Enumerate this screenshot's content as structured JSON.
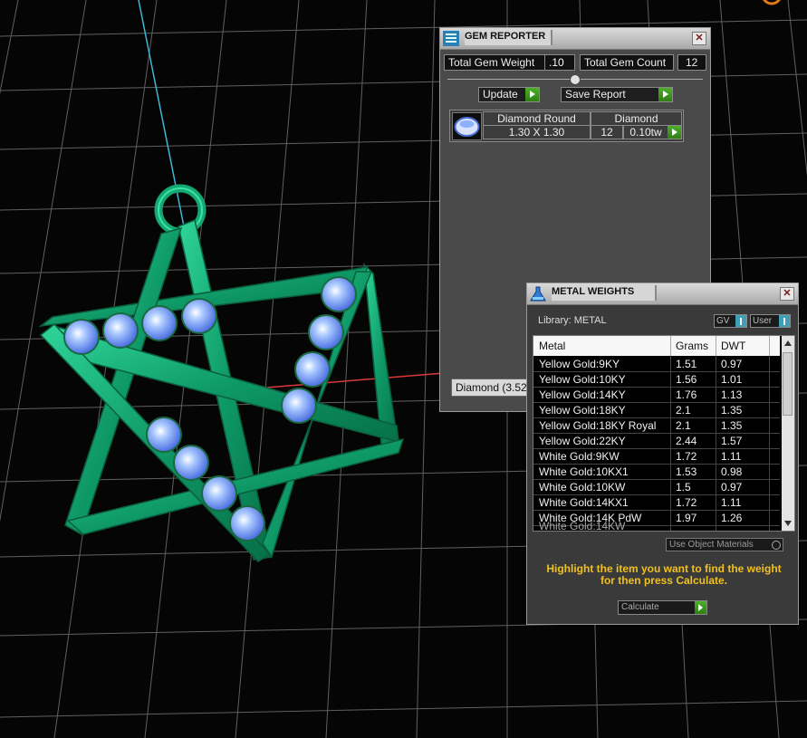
{
  "gem_reporter": {
    "title": "GEM REPORTER",
    "close": "✕",
    "total_weight_label": "Total Gem Weight",
    "total_weight_value": ".10",
    "total_count_label": "Total Gem Count",
    "total_count_value": "12",
    "update_label": "Update",
    "save_report_label": "Save Report",
    "table": {
      "header_name": "Diamond Round",
      "header_type": "Diamond",
      "size": "1.30 X 1.30",
      "count": "12",
      "weight": "0.10tw"
    },
    "footer_text": "Diamond   (3.52"
  },
  "metal_weights": {
    "title": "METAL WEIGHTS",
    "close": "✕",
    "library_label": "Library: METAL",
    "gv_label": "GV",
    "user_label": "User",
    "columns": [
      "Metal",
      "Grams",
      "DWT"
    ],
    "rows": [
      {
        "metal": "Yellow Gold:9KY",
        "grams": "1.51",
        "dwt": "0.97"
      },
      {
        "metal": "Yellow Gold:10KY",
        "grams": "1.56",
        "dwt": "1.01"
      },
      {
        "metal": "Yellow Gold:14KY",
        "grams": "1.76",
        "dwt": "1.13"
      },
      {
        "metal": "Yellow Gold:18KY",
        "grams": "2.1",
        "dwt": "1.35"
      },
      {
        "metal": "Yellow Gold:18KY Royal",
        "grams": "2.1",
        "dwt": "1.35"
      },
      {
        "metal": "Yellow Gold:22KY",
        "grams": "2.44",
        "dwt": "1.57"
      },
      {
        "metal": "White Gold:9KW",
        "grams": "1.72",
        "dwt": "1.11"
      },
      {
        "metal": "White Gold:10KX1",
        "grams": "1.53",
        "dwt": "0.98"
      },
      {
        "metal": "White Gold:10KW",
        "grams": "1.5",
        "dwt": "0.97"
      },
      {
        "metal": "White Gold:14KX1",
        "grams": "1.72",
        "dwt": "1.11"
      },
      {
        "metal": "White Gold:14K PdW",
        "grams": "1.97",
        "dwt": "1.26"
      }
    ],
    "use_object_materials": "Use Object Materials",
    "hint": "Highlight the item you want to find the weight for then press Calculate.",
    "calculate_label": "Calculate"
  }
}
